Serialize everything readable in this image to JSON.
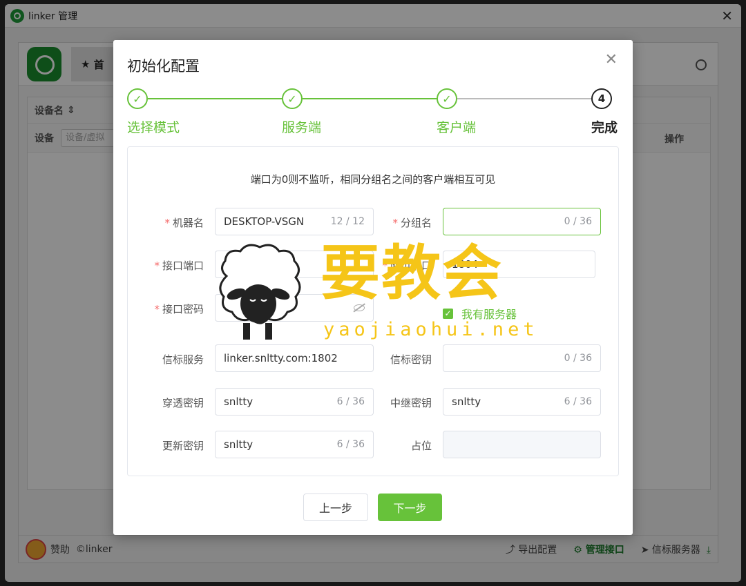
{
  "window": {
    "title": "linker 管理"
  },
  "background": {
    "nav_label": "首",
    "table": {
      "col_device": "设备名",
      "filter_label": "设备",
      "filter_placeholder": "设备/虚拟",
      "col_action": "操作"
    },
    "footer": {
      "donate": "赞助",
      "copyright": "©linker",
      "export": "导出配置",
      "manage": "管理接口",
      "signal": "信标服务器"
    }
  },
  "dialog": {
    "title": "初始化配置",
    "steps": [
      {
        "label": "选择模式",
        "state": "done"
      },
      {
        "label": "服务端",
        "state": "done"
      },
      {
        "label": "客户端",
        "state": "done"
      },
      {
        "label": "完成",
        "number": "4",
        "state": "active"
      }
    ],
    "notice": "端口为0则不监听，相同分组名之间的客户端相互可见",
    "fields": {
      "machine_name": {
        "label": "机器名",
        "value": "DESKTOP-VSGN",
        "count": "12 / 12"
      },
      "group_name": {
        "label": "分组名",
        "value": "",
        "count": "0 / 36"
      },
      "api_port": {
        "label": "接口端口",
        "value": "1803"
      },
      "web_port": {
        "label": "网页端口",
        "value": "1804"
      },
      "api_password": {
        "label": "接口密码",
        "value": "••••••"
      },
      "has_server": {
        "label": "我有服务器",
        "checked": true
      },
      "signal_server": {
        "label": "信标服务",
        "value": "linker.snltty.com:1802"
      },
      "signal_key": {
        "label": "信标密钥",
        "value": "",
        "count": "0 / 36"
      },
      "tunnel_key": {
        "label": "穿透密钥",
        "value": "snltty",
        "count": "6 / 36"
      },
      "relay_key": {
        "label": "中继密钥",
        "value": "snltty",
        "count": "6 / 36"
      },
      "update_key": {
        "label": "更新密钥",
        "value": "snltty",
        "count": "6 / 36"
      },
      "placeholder_field": {
        "label": "占位",
        "value": ""
      }
    },
    "buttons": {
      "prev": "上一步",
      "next": "下一步"
    }
  },
  "watermark": {
    "text": "要教会",
    "url": "yaojiaohui.net"
  },
  "colors": {
    "accent": "#67c23a",
    "required": "#f56c6c",
    "watermark": "#f5c518"
  }
}
